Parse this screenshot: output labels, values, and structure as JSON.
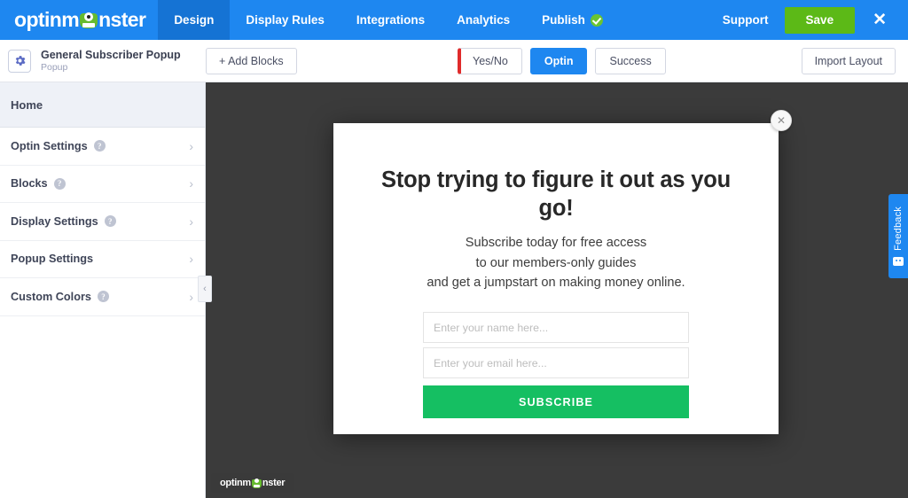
{
  "app": {
    "brand_before": "optinm",
    "brand_after": "nster",
    "brand_icon": "monster-logo-icon"
  },
  "topnav": {
    "items": [
      {
        "label": "Design",
        "active": true
      },
      {
        "label": "Display Rules",
        "active": false
      },
      {
        "label": "Integrations",
        "active": false
      },
      {
        "label": "Analytics",
        "active": false
      },
      {
        "label": "Publish",
        "active": false,
        "badge": "published-check"
      }
    ],
    "support_label": "Support",
    "save_label": "Save",
    "close_label": "✕"
  },
  "toolbar": {
    "campaign_name": "General Subscriber Popup",
    "campaign_type": "Popup",
    "add_blocks_label": "+ Add Blocks",
    "import_layout_label": "Import Layout",
    "view_tabs": [
      {
        "label": "Yes/No",
        "state": "disabled"
      },
      {
        "label": "Optin",
        "state": "active"
      },
      {
        "label": "Success",
        "state": "default"
      }
    ]
  },
  "sidebar": {
    "home_label": "Home",
    "items": [
      {
        "label": "Optin Settings",
        "help": true
      },
      {
        "label": "Blocks",
        "help": true
      },
      {
        "label": "Display Settings",
        "help": true
      },
      {
        "label": "Popup Settings",
        "help": false
      },
      {
        "label": "Custom Colors",
        "help": true
      }
    ],
    "help_glyph": "?",
    "chevron_glyph": "›",
    "collapse_glyph": "‹"
  },
  "popup": {
    "close_glyph": "✕",
    "headline": "Stop trying to figure it out as you go!",
    "subtext_lines": [
      "Subscribe today for free access",
      "to our members-only guides",
      "and get a jumpstart on making money online."
    ],
    "name_placeholder": "Enter your name here...",
    "email_placeholder": "Enter your email here...",
    "name_value": "",
    "email_value": "",
    "subscribe_label": "SUBSCRIBE",
    "watermark_before": "optinm",
    "watermark_after": "nster"
  },
  "feedback": {
    "label": "Feedback"
  },
  "colors": {
    "brand_blue": "#1e87f0",
    "nav_active_blue": "#1573d4",
    "save_green": "#5cb917",
    "subscribe_green": "#15bf62",
    "canvas_dark": "#3b3b3b",
    "disabled_red": "#e02b2b",
    "sidebar_active": "#eef1f7"
  }
}
